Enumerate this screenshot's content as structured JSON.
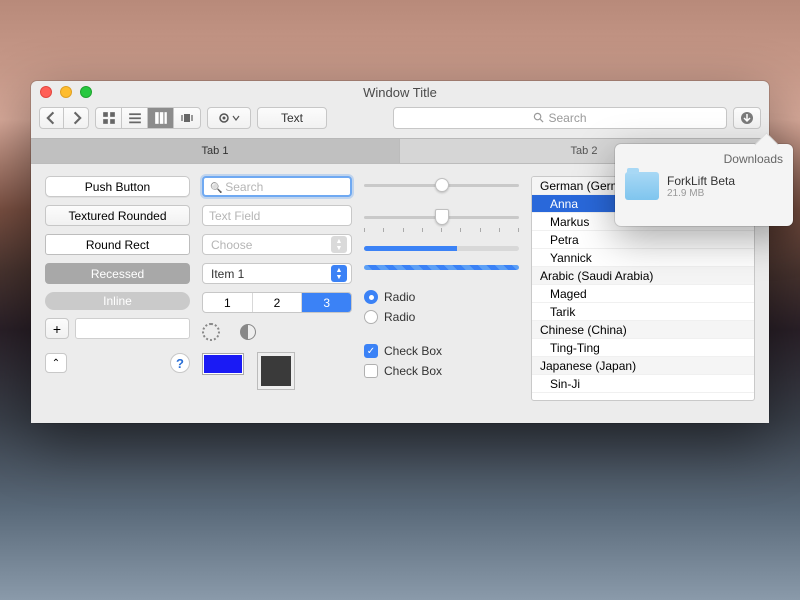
{
  "window": {
    "title": "Window Title"
  },
  "toolbar": {
    "text_button": "Text",
    "search_placeholder": "Search"
  },
  "tabs": [
    "Tab 1",
    "Tab 2"
  ],
  "active_tab": 0,
  "buttons": {
    "push": "Push Button",
    "textured": "Textured Rounded",
    "roundrect": "Round Rect",
    "recessed": "Recessed",
    "inline": "Inline"
  },
  "col2": {
    "search_placeholder": "Search",
    "textfield_placeholder": "Text Field",
    "combo_disabled": "Choose",
    "combo_enabled": "Item 1",
    "seg": [
      "1",
      "2",
      "3"
    ],
    "seg_selected": 2
  },
  "sliders": {
    "s1_value_pct": 50,
    "s2_value_pct": 50,
    "progress_pct": 60
  },
  "radio_label": "Radio",
  "check_label": "Check Box",
  "list": [
    {
      "type": "group",
      "label": "German (Germ"
    },
    {
      "type": "item",
      "label": "Anna",
      "selected": true
    },
    {
      "type": "item",
      "label": "Markus"
    },
    {
      "type": "item",
      "label": "Petra"
    },
    {
      "type": "item",
      "label": "Yannick"
    },
    {
      "type": "group",
      "label": "Arabic (Saudi Arabia)"
    },
    {
      "type": "item",
      "label": "Maged"
    },
    {
      "type": "item",
      "label": "Tarik"
    },
    {
      "type": "group",
      "label": "Chinese (China)"
    },
    {
      "type": "item",
      "label": "Ting-Ting"
    },
    {
      "type": "group",
      "label": "Japanese (Japan)"
    },
    {
      "type": "item",
      "label": "Sin-Ji"
    }
  ],
  "popover": {
    "title": "Downloads",
    "item_name": "ForkLift Beta",
    "item_sub": "21.9 MB"
  }
}
